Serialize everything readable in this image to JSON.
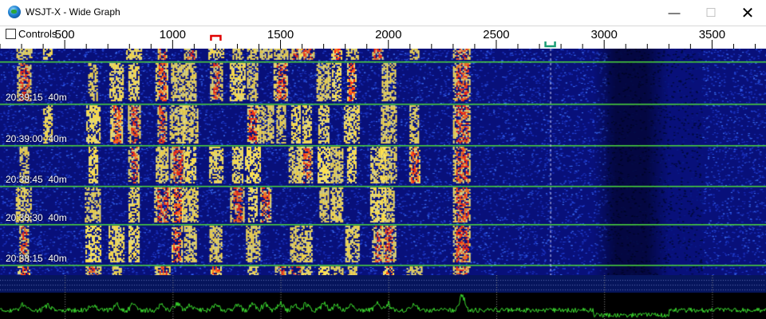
{
  "window": {
    "title": "WSJT-X - Wide Graph",
    "minimize_glyph": "—",
    "maximize_glyph": "☐",
    "close_glyph": "✕"
  },
  "controls": {
    "label": "Controls",
    "checked": false
  },
  "scale": {
    "min_hz": 200,
    "max_hz": 3750,
    "labels": [
      500,
      1000,
      1500,
      2000,
      2500,
      3000,
      3500
    ],
    "rx_marker_hz": 1200,
    "tx_marker_hz": 2750,
    "colors": {
      "rx_marker": "#e00000",
      "tx_marker": "#1a9c74"
    }
  },
  "timestamps": [
    {
      "time": "20:39:15",
      "band": "40m"
    },
    {
      "time": "20:39:00",
      "band": "40m"
    },
    {
      "time": "20:38:45",
      "band": "40m"
    },
    {
      "time": "20:38:30",
      "band": "40m"
    },
    {
      "time": "20:38:15",
      "band": "40m"
    }
  ],
  "waterfall": {
    "signals_hz": [
      310,
      420,
      630,
      740,
      820,
      950,
      1020,
      1080,
      1200,
      1300,
      1370,
      1430,
      1500,
      1570,
      1620,
      1700,
      1760,
      1830,
      1950,
      2000,
      2120,
      2340
    ],
    "colors": {
      "background": "#08107a",
      "separator": "#4cd93a",
      "spectrum": "#3bdc2f"
    }
  },
  "icons": {
    "app": "globe-icon"
  }
}
